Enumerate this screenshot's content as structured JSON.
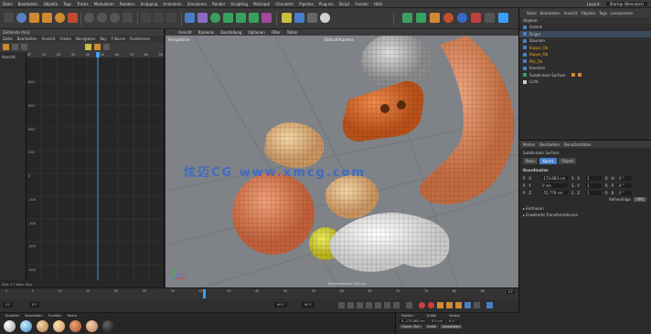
{
  "menubar": {
    "items": [
      "Datei",
      "Bearbeiten",
      "Objekte",
      "Tags",
      "Tracks",
      "Modulieren",
      "Rendern",
      "Snapping",
      "Animieren",
      "Simulieren",
      "Render",
      "Sculpting",
      "MoGraph",
      "Charakter",
      "Pipeline",
      "Plug-ins",
      "Skript",
      "Fenster",
      "Hilfe"
    ],
    "layout_label": "Layout:",
    "layout_value": "Startup (Benutzer)"
  },
  "left_panel": {
    "header_title": "Zeitleiste (Ani)",
    "menu": [
      "Datei",
      "Bearbeiten",
      "Ansicht",
      "Frame",
      "Navigation",
      "Key",
      "F-Kurve",
      "Funktionen"
    ],
    "track_label": "Ansicht",
    "ruler_ticks": [
      "0F",
      "10",
      "20",
      "30",
      "40",
      "50",
      "60",
      "70",
      "80",
      "90"
    ],
    "y_ticks": [
      "800",
      "600",
      "400",
      "200",
      "0",
      "-200",
      "-400",
      "-600",
      "-800"
    ],
    "status_text": "Zeit: 0 F  Wert:  Key:"
  },
  "viewport": {
    "menu": [
      "Ansicht",
      "Kameras",
      "Darstellung",
      "Optionen",
      "Filter",
      "Tafeln"
    ],
    "camera_label": "Perspektive",
    "default_camera": "Default-Kamera",
    "watermark": "炫迈CG  www.xmcg.com",
    "grid_info": "Rasterabstand: 100 cm"
  },
  "right_panel": {
    "tabs": [
      "Datei",
      "Bearbeiten",
      "Ansicht",
      "Objekte",
      "Tags",
      "Lesezeichen"
    ],
    "object_header": "Objekte",
    "objects": [
      {
        "name": "Gelenk",
        "color": "#9a9a9a"
      },
      {
        "name": "Finger",
        "color": "#e0e0e0"
      },
      {
        "name": "Daumen",
        "color": "#9a9a9a"
      },
      {
        "name": "Kappe_Ob",
        "color": "#f0a020"
      },
      {
        "name": "Kappe_Ob",
        "color": "#f0a020"
      },
      {
        "name": "Pilz_Ob",
        "color": "#f0a020"
      },
      {
        "name": "Knochen",
        "color": "#9a9a9a"
      },
      {
        "name": "Subdivision Surface",
        "color": "#9a9a9a"
      },
      {
        "name": "Licht",
        "color": "#9a9a9a"
      }
    ],
    "attr_tabs": [
      "Modus",
      "Bearbeiten",
      "Benutzerdaten"
    ],
    "attr_title": "Subdivision Surface",
    "attr_subtabs": [
      "Basis",
      "Koord.",
      "Objekt"
    ],
    "coord_header": "Koordinaten",
    "coords": [
      {
        "axis": "P . X",
        "value": "-173.083 cm",
        "axis2": "S . X",
        "value2": "1",
        "axis3": "R . H",
        "value3": "0 °"
      },
      {
        "axis": "P . Y",
        "value": "0 cm",
        "axis2": "S . Y",
        "value2": "1",
        "axis3": "R . P",
        "value3": "0 °"
      },
      {
        "axis": "P . Z",
        "value": "-55.779 cm",
        "axis2": "S . Z",
        "value2": "1",
        "axis3": "R . B",
        "value3": "0 °"
      }
    ],
    "order_label": "Reihenfolge",
    "order_value": "HPB",
    "sections": [
      "Einfrieren",
      "Erweiterte Transformationen"
    ]
  },
  "timeline": {
    "ticks": [
      "0",
      "5",
      "10",
      "15",
      "20",
      "25",
      "30",
      "35",
      "40",
      "45",
      "50",
      "55",
      "60",
      "65",
      "70",
      "75",
      "80",
      "85",
      "90"
    ],
    "current_frame": "0 F",
    "start": "0 F",
    "end": "90 F",
    "min": "0 F",
    "max": "90 F"
  },
  "materials": {
    "menu": [
      "Erstellen",
      "Bearbeiten",
      "Funktion",
      "Textur"
    ],
    "balls": [
      "#e8e8e8",
      "#7ac0e0",
      "#c8a070",
      "#f0c080",
      "#d08858",
      "#e8b890",
      "#2a2a2a"
    ]
  },
  "coord_bar": {
    "labels": [
      "Position",
      "Größe",
      "Winkel"
    ],
    "values": [
      "X -173.083 cm",
      "X 0 cm",
      "H 0 °"
    ],
    "mode1": "Objekt (Rel)",
    "mode2": "Größe",
    "apply": "Anwenden"
  },
  "colors": {
    "accent": "#4a7ec8",
    "timeline_marker": "#3aa0ff"
  }
}
